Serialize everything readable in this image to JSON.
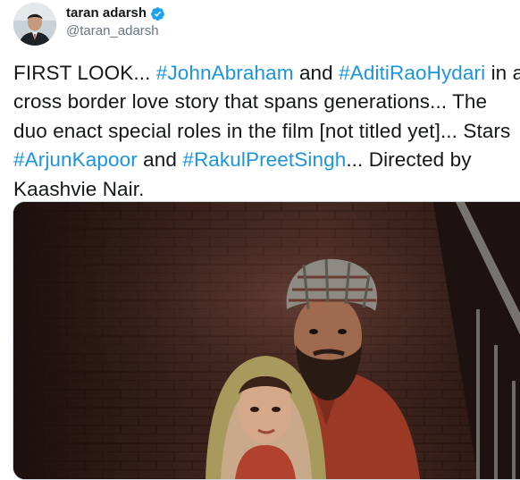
{
  "author": {
    "display_name": "taran adarsh",
    "handle": "@taran_adarsh",
    "avatar_icon": "user-avatar",
    "verified_icon": "verified-badge-icon",
    "verified_color": "#1da1f2"
  },
  "tweet": {
    "lines": [
      [
        {
          "text": "FIRST LOOK... ",
          "type": "text"
        },
        {
          "text": "#JohnAbraham",
          "type": "hashtag"
        },
        {
          "text": " and ",
          "type": "text"
        },
        {
          "text": "#AditiRaoHydari",
          "type": "hashtag"
        },
        {
          "text": " in a",
          "type": "text"
        }
      ],
      [
        {
          "text": "cross border love story that spans generations... The",
          "type": "text"
        }
      ],
      [
        {
          "text": "duo enact special roles in the film [not titled yet]... Stars",
          "type": "text"
        }
      ],
      [
        {
          "text": "#ArjunKapoor",
          "type": "hashtag"
        },
        {
          "text": " and ",
          "type": "text"
        },
        {
          "text": "#RakulPreetSingh",
          "type": "hashtag"
        },
        {
          "text": "... Directed by",
          "type": "text"
        }
      ],
      [
        {
          "text": "Kaashvie Nair.",
          "type": "text"
        }
      ]
    ],
    "hashtag_color": "#1b95e0"
  },
  "media": {
    "type": "photo",
    "icon": "film-still-image"
  }
}
